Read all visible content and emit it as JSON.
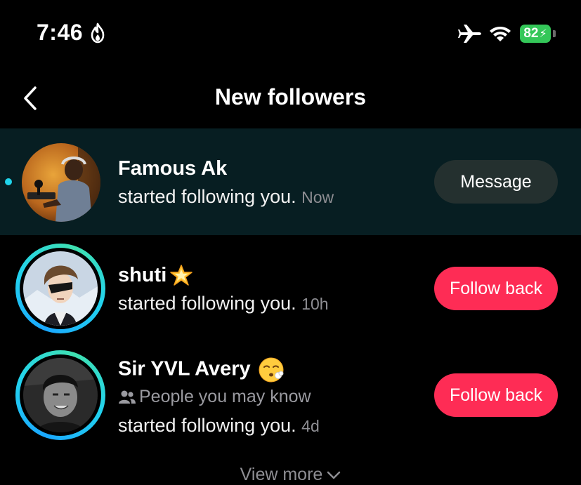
{
  "status_bar": {
    "time": "7:46",
    "battery": "82"
  },
  "header": {
    "title": "New followers"
  },
  "followers": [
    {
      "name": "Famous Ak",
      "action": "started following you.",
      "time": "Now",
      "button": "Message",
      "unread": true
    },
    {
      "name": "shuti",
      "action": "started following you.",
      "time": "10h",
      "button": "Follow back"
    },
    {
      "name": "Sir YVL Avery",
      "mutual": "People you may know",
      "action": "started following you.",
      "time": "4d",
      "button": "Follow back"
    }
  ],
  "view_more": "View more",
  "colors": {
    "follow_button": "#fe2c55",
    "message_button": "#24302f",
    "highlight_row": "#071e22",
    "unread_dot": "#20d5ec",
    "battery": "#34c759"
  }
}
